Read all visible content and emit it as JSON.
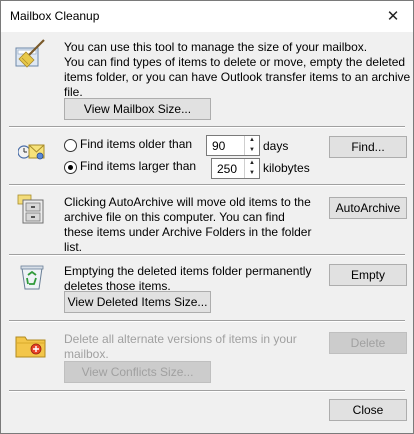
{
  "window": {
    "title": "Mailbox Cleanup",
    "close_glyph": "✕"
  },
  "section_size": {
    "icon": "broom-mailbox-icon",
    "line1": "You can use this tool to manage the size of your mailbox.",
    "desc_lines": [
      "You can find types of items to delete or move, empty the deleted",
      "items folder, or you can have Outlook transfer items to an archive",
      "file."
    ],
    "view_button": "View Mailbox Size..."
  },
  "section_find": {
    "icon": "find-items-icon",
    "older": {
      "label": "Find items older than",
      "value": "90",
      "unit": "days",
      "selected": false
    },
    "larger": {
      "label": "Find items larger than",
      "value": "250",
      "unit": "kilobytes",
      "selected": true
    },
    "find_button": "Find..."
  },
  "section_archive": {
    "icon": "archive-cabinet-icon",
    "lines": [
      "Clicking AutoArchive will move old items to the",
      "archive file on this computer. You can find",
      "these items under Archive Folders in the folder",
      "list."
    ],
    "button": "AutoArchive"
  },
  "section_deleted": {
    "icon": "recycle-bin-icon",
    "lines": [
      "Emptying the deleted items folder permanently",
      "deletes those items."
    ],
    "empty_button": "Empty",
    "view_button": "View Deleted Items Size..."
  },
  "section_conflicts": {
    "icon": "conflicts-folder-icon",
    "lines": [
      "Delete all alternate versions of items in your",
      "mailbox."
    ],
    "delete_button": "Delete",
    "view_button": "View Conflicts Size..."
  },
  "footer": {
    "close_button": "Close"
  }
}
